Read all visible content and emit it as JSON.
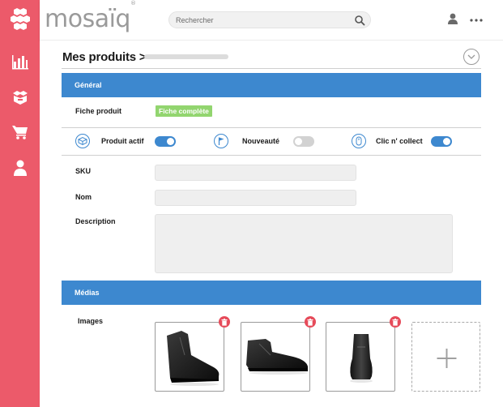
{
  "brand": {
    "name": "mosaïq",
    "mark": "®"
  },
  "search": {
    "placeholder": "Rechercher"
  },
  "page": {
    "title": "Mes produits >"
  },
  "general": {
    "title": "Général",
    "fiche_label": "Fiche produit",
    "fiche_status": "Fiche complète",
    "status_color": "#92d56f"
  },
  "features": [
    {
      "label": "Produit actif",
      "icon": "box-icon",
      "enabled": true
    },
    {
      "label": "Nouveauté",
      "icon": "flag-icon",
      "enabled": false
    },
    {
      "label": "Clic n' collect",
      "icon": "mouse-icon",
      "enabled": true
    }
  ],
  "form": {
    "sku_label": "SKU",
    "sku_value": "",
    "nom_label": "Nom",
    "nom_value": "",
    "description_label": "Description",
    "description_value": ""
  },
  "media": {
    "title": "Médias",
    "images_label": "Images",
    "images": [
      {
        "alt": "Black leather ankle boot, three-quarter view"
      },
      {
        "alt": "Black leather ankle boot, side view"
      },
      {
        "alt": "Black leather ankle boot, front view"
      }
    ],
    "add_icon": "plus-icon"
  },
  "sidebar": {
    "items": [
      {
        "icon": "bar-chart-icon"
      },
      {
        "icon": "box-open-icon"
      },
      {
        "icon": "cart-icon"
      },
      {
        "icon": "user-icon"
      }
    ]
  },
  "colors": {
    "sidebar": "#ec5a6a",
    "accent": "#3d88cf",
    "delete": "#e64b5a",
    "toggle_off": "#d2d2d2"
  }
}
